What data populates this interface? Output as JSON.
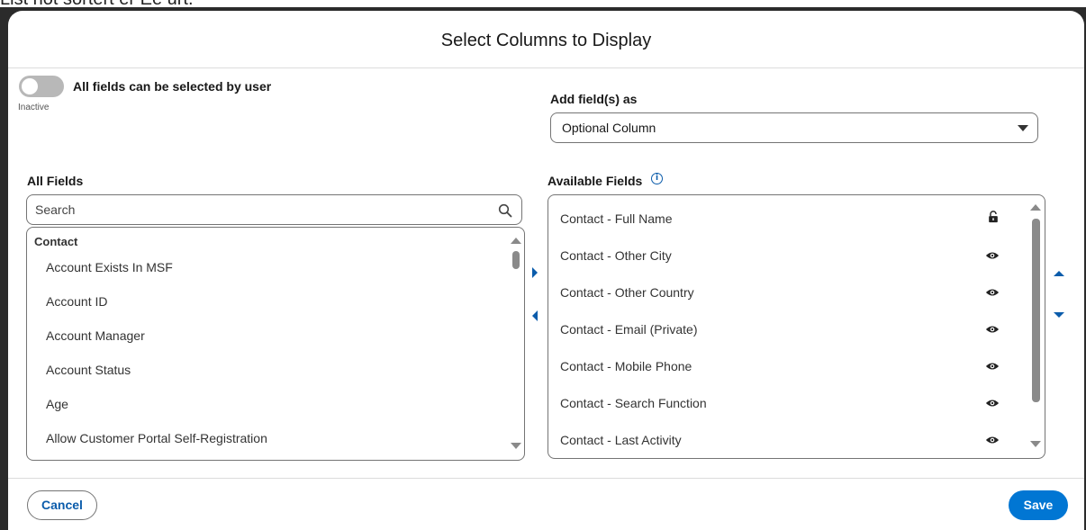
{
  "background_text": "List not sortert er Ee urt.",
  "modal": {
    "title": "Select Columns to Display"
  },
  "toggle": {
    "label": "All fields can be selected by user",
    "state": "Inactive"
  },
  "add_as": {
    "label": "Add field(s) as",
    "value": "Optional Column"
  },
  "all_fields": {
    "label": "All Fields",
    "search_placeholder": "Search",
    "group": "Contact",
    "items": [
      "Account Exists In MSF",
      "Account ID",
      "Account Manager",
      "Account Status",
      "Age",
      "Allow Customer Portal Self-Registration"
    ]
  },
  "available_fields": {
    "label": "Available Fields",
    "items": [
      {
        "label": "Contact - Full Name",
        "icon": "lock-icon"
      },
      {
        "label": "Contact - Other City",
        "icon": "eye-icon"
      },
      {
        "label": "Contact - Other Country",
        "icon": "eye-icon"
      },
      {
        "label": "Contact - Email (Private)",
        "icon": "eye-icon"
      },
      {
        "label": "Contact - Mobile Phone",
        "icon": "eye-icon"
      },
      {
        "label": "Contact - Search Function",
        "icon": "eye-icon"
      },
      {
        "label": "Contact - Last Activity",
        "icon": "eye-icon"
      }
    ]
  },
  "footer": {
    "cancel_label": "Cancel",
    "save_label": "Save"
  },
  "colors": {
    "brand_blue": "#0176d3",
    "link_blue": "#0b5cab",
    "toggle_off": "#b8b8b8"
  }
}
